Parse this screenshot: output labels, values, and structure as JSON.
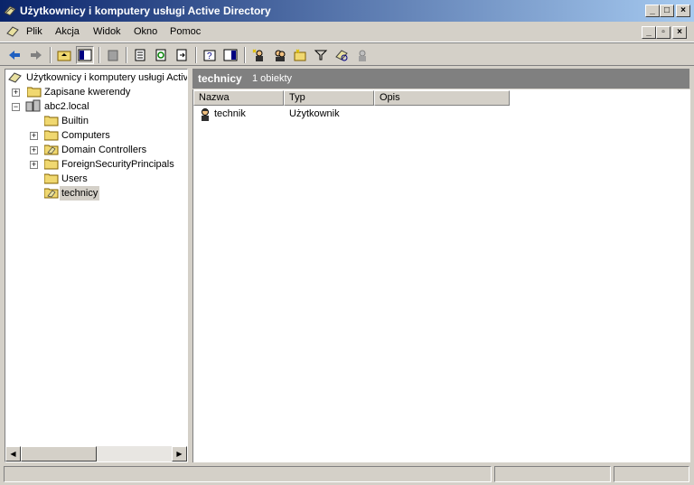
{
  "window": {
    "title": "Użytkownicy i komputery usługi Active Directory"
  },
  "menu": {
    "items": [
      {
        "label": "Plik"
      },
      {
        "label": "Akcja"
      },
      {
        "label": "Widok"
      },
      {
        "label": "Okno"
      },
      {
        "label": "Pomoc"
      }
    ]
  },
  "tree": {
    "root": "Użytkownicy i komputery usługi Activ",
    "saved_queries": "Zapisane kwerendy",
    "domain": "abc2.local",
    "children": [
      {
        "label": "Builtin"
      },
      {
        "label": "Computers"
      },
      {
        "label": "Domain Controllers"
      },
      {
        "label": "ForeignSecurityPrincipals"
      },
      {
        "label": "Users"
      },
      {
        "label": "technicy"
      }
    ]
  },
  "details": {
    "title": "technicy",
    "count": "1 obiekty",
    "columns": [
      "Nazwa",
      "Typ",
      "Opis"
    ],
    "rows": [
      {
        "name": "technik",
        "type": "Użytkownik",
        "description": ""
      }
    ]
  },
  "colors": {
    "title_start": "#0a246a",
    "title_end": "#a6caf0",
    "face": "#d4d0c8",
    "header_bg": "#808080"
  }
}
